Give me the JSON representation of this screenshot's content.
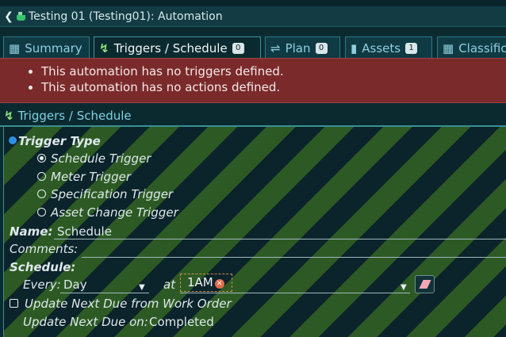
{
  "title": "Testing 01 (Testing01): Automation",
  "icons": {
    "back": "chevron-left-icon",
    "app": "beaker-icon",
    "bolt": "bolt-icon"
  },
  "colors": {
    "alert_bg": "#7b2a2b",
    "accent": "#7fd1e2",
    "stripe_green": "#2d5a24",
    "stripe_dark": "#0b232a"
  },
  "tabs": [
    {
      "label": "Summary",
      "icon": "list-icon",
      "count": ""
    },
    {
      "label": "Triggers / Schedule",
      "icon": "bolt-icon",
      "count": "0",
      "active": true
    },
    {
      "label": "Plan",
      "icon": "plan-icon",
      "count": "0"
    },
    {
      "label": "Assets",
      "icon": "assets-icon",
      "count": "1"
    },
    {
      "label": "Classific",
      "icon": "classification-icon",
      "count": ""
    }
  ],
  "alerts": [
    "This automation has no triggers defined.",
    "This automation has no actions defined."
  ],
  "section": {
    "title": "Triggers / Schedule"
  },
  "form": {
    "trigger_type_label": "Trigger Type",
    "trigger_options": [
      {
        "label": "Schedule Trigger",
        "selected": true
      },
      {
        "label": "Meter Trigger",
        "selected": false
      },
      {
        "label": "Specification Trigger",
        "selected": false
      },
      {
        "label": "Asset Change Trigger",
        "selected": false
      }
    ],
    "name_label": "Name:",
    "name_value": "Schedule",
    "comments_label": "Comments:",
    "comments_value": "",
    "schedule_label": "Schedule:",
    "every_label": "Every:",
    "every_value": "Day",
    "at_label": "at",
    "at_value": "1AM",
    "update_from_wo_label": "Update Next Due from Work Order",
    "update_from_wo_checked": false,
    "update_on_label": "Update Next Due on:",
    "update_on_value": "Completed"
  }
}
